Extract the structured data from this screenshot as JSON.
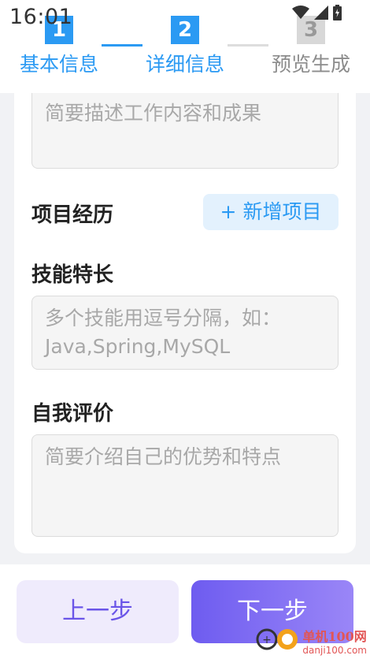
{
  "status_bar": {
    "time": "16:01"
  },
  "stepper": {
    "steps": [
      {
        "number": "1",
        "label": "基本信息"
      },
      {
        "number": "2",
        "label": "详细信息"
      },
      {
        "number": "3",
        "label": "预览生成"
      }
    ]
  },
  "form": {
    "work_description": {
      "placeholder": "简要描述工作内容和成果"
    },
    "projects": {
      "title": "项目经历",
      "add_label": "+ 新增项目"
    },
    "skills": {
      "title": "技能特长",
      "placeholder": "多个技能用逗号分隔，如：Java,Spring,MySQL"
    },
    "self_evaluation": {
      "title": "自我评价",
      "placeholder": "简要介绍自己的优势和特点"
    }
  },
  "footer": {
    "prev_label": "上一步",
    "next_label": "下一步"
  },
  "watermark": {
    "line1": "单机100网",
    "line2": "danji100.com"
  },
  "colors": {
    "accent": "#2b9af3",
    "primary_button": "#7b68ee",
    "secondary_button": "#efebfc"
  }
}
